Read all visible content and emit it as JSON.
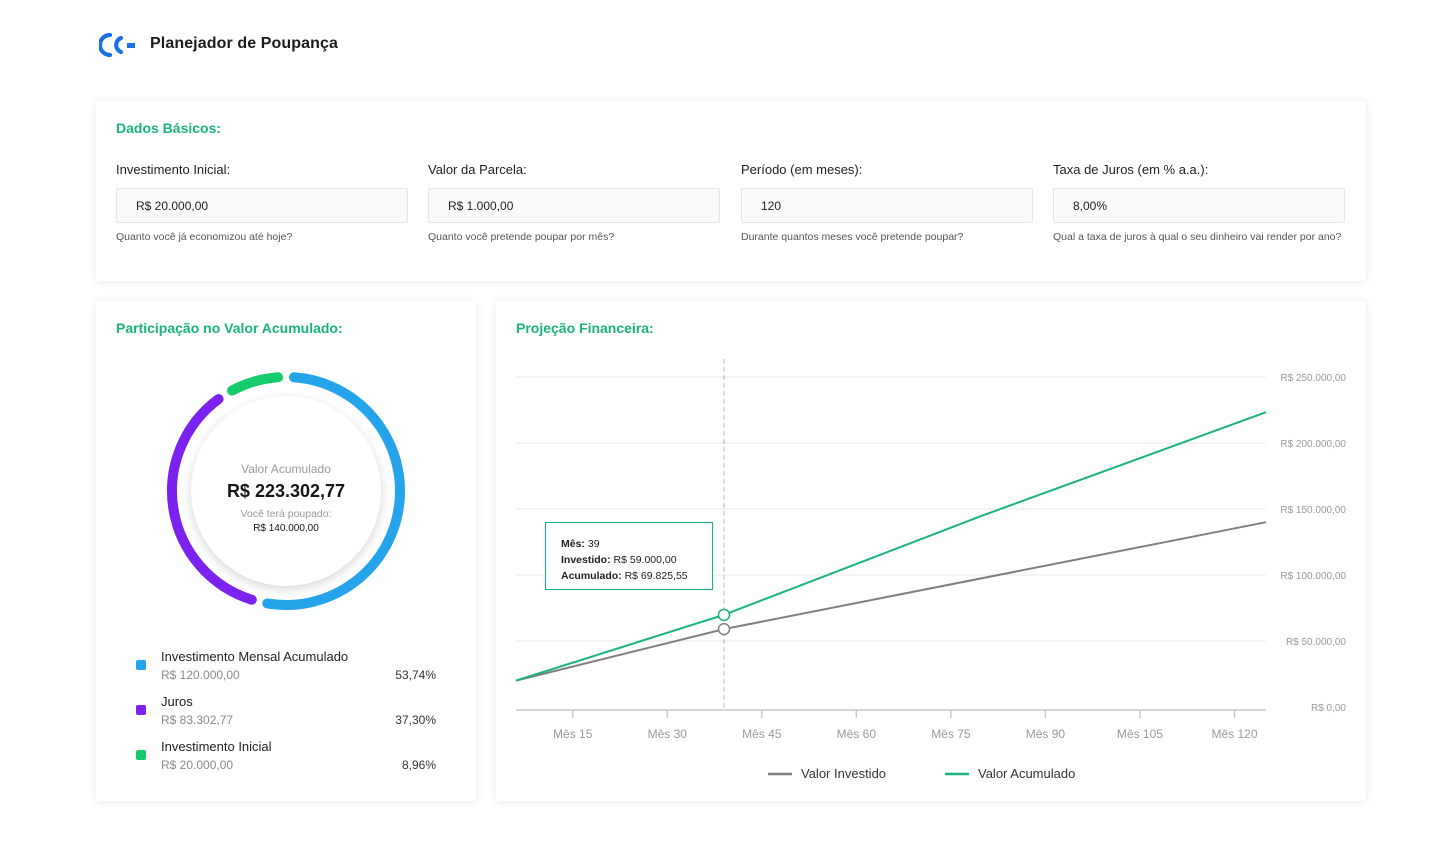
{
  "app": {
    "title": "Planejador de Poupança",
    "logo_icon": "cc-logo-icon",
    "brand_color": "#1971e8"
  },
  "basic": {
    "title": "Dados Básicos:",
    "fields": [
      {
        "label": "Investimento Inicial:",
        "value": "R$ 20.000,00",
        "help": "Quanto você já economizou até hoje?"
      },
      {
        "label": "Valor da Parcela:",
        "value": "R$ 1.000,00",
        "help": "Quanto você pretende poupar por mês?"
      },
      {
        "label": "Período (em meses):",
        "value": "120",
        "help": "Durante quantos meses você pretende poupar?"
      },
      {
        "label": "Taxa de Juros (em % a.a.):",
        "value": "8,00%",
        "help": "Qual a taxa de juros à qual o seu dinheiro vai render por ano?"
      }
    ]
  },
  "share": {
    "title": "Participação no Valor Acumulado:",
    "center_label": "Valor Acumulado",
    "center_value": "R$ 223.302,77",
    "center_sub": "Você terá poupado:",
    "center_subvalue": "R$ 140.000,00",
    "items": [
      {
        "name": "Investimento Mensal Acumulado",
        "value": "R$ 120.000,00",
        "pct": "53,74%",
        "fraction": 0.5374,
        "color": "#25a4ec"
      },
      {
        "name": "Juros",
        "value": "R$ 83.302,77",
        "pct": "37,30%",
        "fraction": 0.373,
        "color": "#7b22f0"
      },
      {
        "name": "Investimento Inicial",
        "value": "R$ 20.000,00",
        "pct": "8,96%",
        "fraction": 0.0896,
        "color": "#14cc6c"
      }
    ]
  },
  "projection": {
    "title": "Projeção Financeira:",
    "tooltip": {
      "month_label": "Mês:",
      "month_value": "39",
      "invested_label": "Investido:",
      "invested_value": "R$ 59.000,00",
      "accum_label": "Acumulado:",
      "accum_value": "R$ 69.825,55"
    },
    "legend": [
      "Valor Investido",
      "Valor Acumulado"
    ]
  },
  "chart_data": {
    "type": "line",
    "x_range": [
      6,
      125
    ],
    "x_ticks": [
      15,
      30,
      45,
      60,
      75,
      90,
      105,
      120
    ],
    "x_tick_labels": [
      "Mês 15",
      "Mês 30",
      "Mês 45",
      "Mês 60",
      "Mês 75",
      "Mês 90",
      "Mês 105",
      "Mês 120"
    ],
    "y_ticks": [
      0,
      50000,
      100000,
      150000,
      200000,
      250000
    ],
    "y_tick_labels": [
      "R$ 0,00",
      "R$ 50.000,00",
      "R$ 100.000,00",
      "R$ 150.000,00",
      "R$ 200.000,00",
      "R$ 250.000,00"
    ],
    "ylim": [
      0,
      250000
    ],
    "grid": true,
    "legend_position": "bottom",
    "highlight_x": 39,
    "series": [
      {
        "name": "Valor Investido",
        "color": "#808080",
        "x": [
          6,
          39,
          125
        ],
        "y": [
          20000,
          59000,
          140000
        ]
      },
      {
        "name": "Valor Acumulado",
        "color": "#19b37b",
        "x": [
          6,
          39,
          80,
          125
        ],
        "y": [
          20000,
          69825.55,
          145000,
          223302.77
        ]
      }
    ]
  }
}
